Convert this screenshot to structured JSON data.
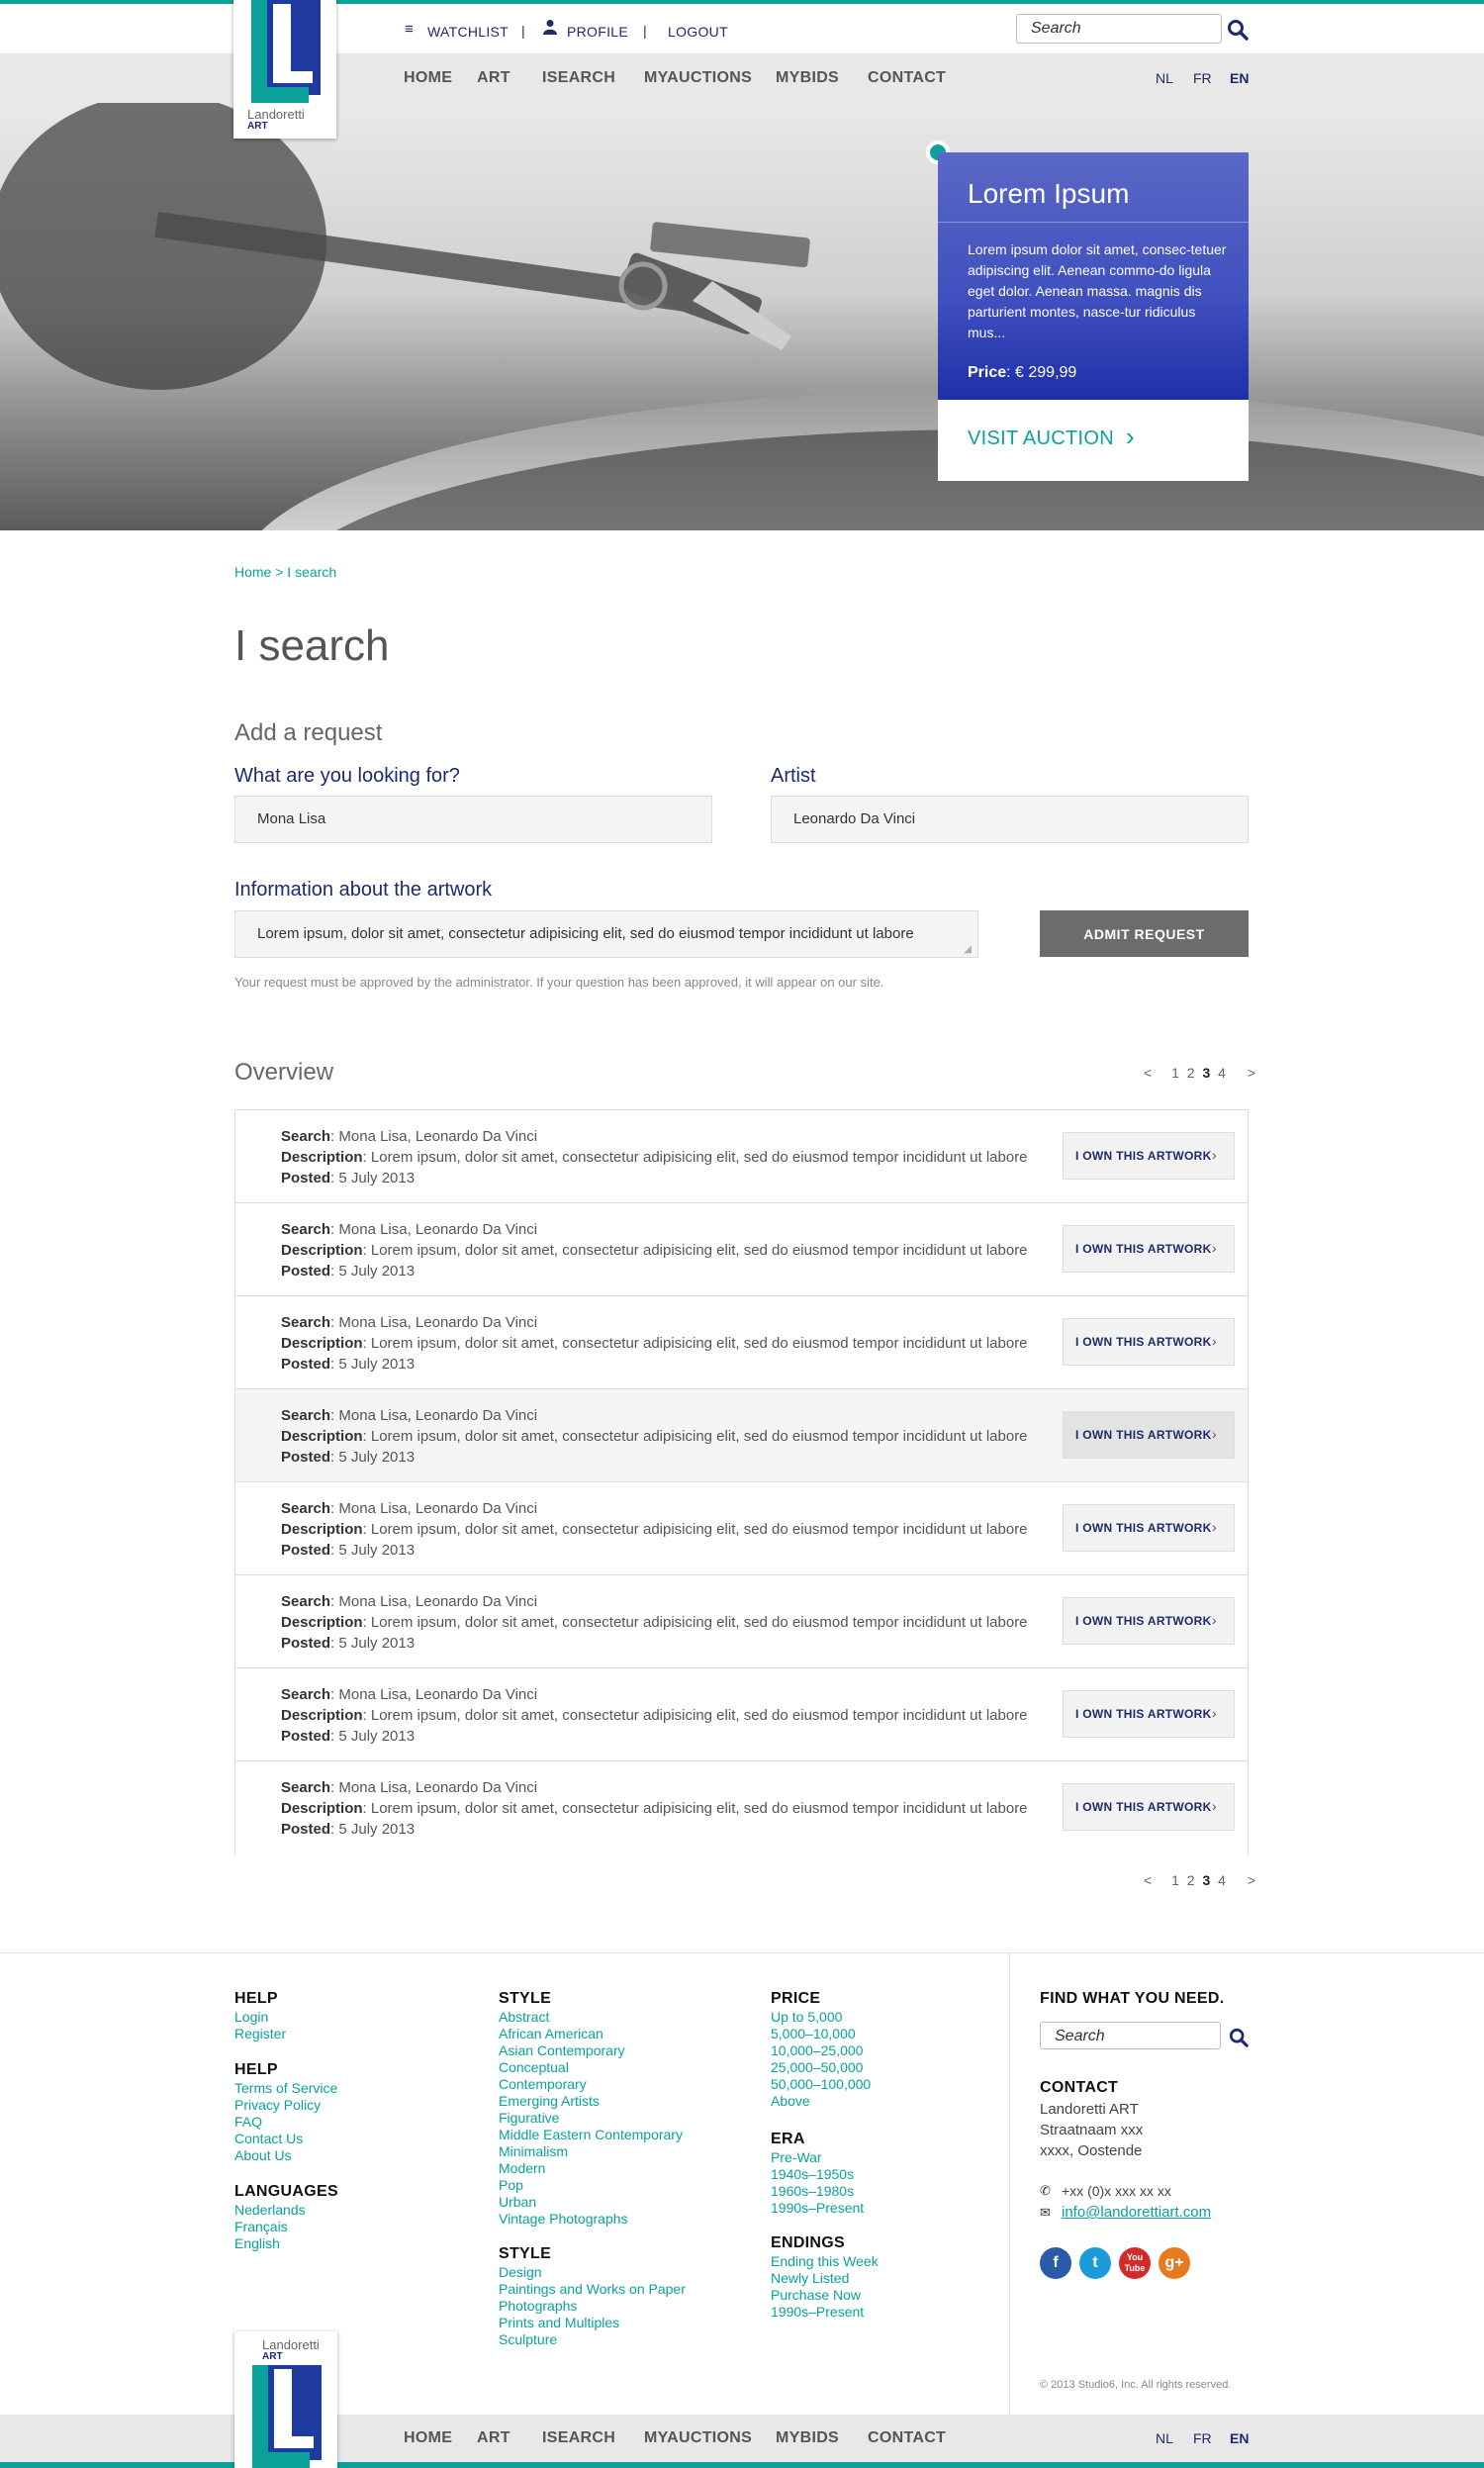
{
  "header": {
    "watchlist": "WATCHLIST",
    "profile": "PROFILE",
    "logout": "LOGOUT",
    "separator": "|",
    "search_placeholder": "Search",
    "logo_name": "Landoretti",
    "logo_art": "ART",
    "logo_letter": "L"
  },
  "nav": {
    "items": [
      "HOME",
      "ART",
      "ISEARCH",
      "MYAUCTIONS",
      "MYBIDS",
      "CONTACT"
    ],
    "languages": [
      "NL",
      "FR",
      "EN"
    ],
    "active_language": "EN"
  },
  "hero": {
    "title": "Lorem Ipsum",
    "body": "Lorem ipsum dolor sit amet, consec-tetuer adipiscing elit. Aenean commo-do ligula eget dolor. Aenean massa. magnis dis parturient montes, nasce-tur ridiculus mus...",
    "price_label": "Price",
    "price_value": "€ 299,99",
    "cta": "VISIT AUCTION",
    "cta_chevron": "›"
  },
  "breadcrumb": "Home > I search",
  "page_title": "I search",
  "form": {
    "heading": "Add a request",
    "what_label": "What are you looking for?",
    "what_value": "Mona Lisa",
    "artist_label": "Artist",
    "artist_value": "Leonardo Da Vinci",
    "info_label": "Information about the artwork",
    "info_value": "Lorem ipsum, dolor sit amet, consectetur adipisicing elit, sed do eiusmod tempor incididunt ut labore",
    "submit": "ADMIT REQUEST",
    "note": "Your request must be approved by the administrator. If your question has been approved, it will appear on our site."
  },
  "overview": {
    "heading": "Overview",
    "pager": {
      "prev": "<",
      "pages": [
        "1",
        "2",
        "3",
        "4"
      ],
      "current": "3",
      "next": ">"
    },
    "labels": {
      "search": "Search",
      "description": "Description",
      "posted": "Posted"
    },
    "button": "I OWN THIS ARTWORK",
    "button_chevron": "›",
    "rows": [
      {
        "search": "Mona Lisa, Leonardo Da Vinci",
        "description": "Lorem ipsum, dolor sit amet, consectetur adipisicing elit, sed do eiusmod tempor incididunt ut labore",
        "posted": "5 July 2013"
      },
      {
        "search": "Mona Lisa, Leonardo Da Vinci",
        "description": "Lorem ipsum, dolor sit amet, consectetur adipisicing elit, sed do eiusmod tempor incididunt ut labore",
        "posted": "5 July 2013"
      },
      {
        "search": "Mona Lisa, Leonardo Da Vinci",
        "description": "Lorem ipsum, dolor sit amet, consectetur adipisicing elit, sed do eiusmod tempor incididunt ut labore",
        "posted": "5 July 2013"
      },
      {
        "search": "Mona Lisa, Leonardo Da Vinci",
        "description": "Lorem ipsum, dolor sit amet, consectetur adipisicing elit, sed do eiusmod tempor incididunt ut labore",
        "posted": "5 July 2013"
      },
      {
        "search": "Mona Lisa, Leonardo Da Vinci",
        "description": "Lorem ipsum, dolor sit amet, consectetur adipisicing elit, sed do eiusmod tempor incididunt ut labore",
        "posted": "5 July 2013"
      },
      {
        "search": "Mona Lisa, Leonardo Da Vinci",
        "description": "Lorem ipsum, dolor sit amet, consectetur adipisicing elit, sed do eiusmod tempor incididunt ut labore",
        "posted": "5 July 2013"
      },
      {
        "search": "Mona Lisa, Leonardo Da Vinci",
        "description": "Lorem ipsum, dolor sit amet, consectetur adipisicing elit, sed do eiusmod tempor incididunt ut labore",
        "posted": "5 July 2013"
      },
      {
        "search": "Mona Lisa, Leonardo Da Vinci",
        "description": "Lorem ipsum, dolor sit amet, consectetur adipisicing elit, sed do eiusmod tempor incididunt ut labore",
        "posted": "5 July 2013"
      }
    ]
  },
  "footer": {
    "help1": {
      "heading": "HELP",
      "links": [
        "Login",
        "Register"
      ]
    },
    "help2": {
      "heading": "HELP",
      "links": [
        "Terms of Service",
        "Privacy Policy",
        "FAQ",
        "Contact Us",
        "About Us"
      ]
    },
    "languages": {
      "heading": "LANGUAGES",
      "links": [
        "Nederlands",
        "Français",
        "English"
      ]
    },
    "style1": {
      "heading": "STYLE",
      "links": [
        "Abstract",
        "African American",
        "Asian Contemporary",
        "Conceptual",
        "Contemporary",
        "Emerging Artists",
        "Figurative",
        "Middle Eastern Contemporary",
        "Minimalism",
        "Modern",
        "Pop",
        "Urban",
        "Vintage Photographs"
      ]
    },
    "style2": {
      "heading": "STYLE",
      "links": [
        "Design",
        "Paintings and Works on Paper",
        "Photographs",
        "Prints and Multiples",
        "Sculpture"
      ]
    },
    "price": {
      "heading": "PRICE",
      "links": [
        "Up to 5,000",
        "5,000–10,000",
        "10,000–25,000",
        "25,000–50,000",
        "50,000–100,000",
        "Above"
      ]
    },
    "era": {
      "heading": "ERA",
      "links": [
        "Pre-War",
        "1940s–1950s",
        "1960s–1980s",
        "1990s–Present"
      ]
    },
    "endings": {
      "heading": "ENDINGS",
      "links": [
        "Ending this Week",
        "Newly Listed",
        "Purchase Now",
        "1990s–Present"
      ]
    },
    "find": {
      "heading": "FIND WHAT YOU NEED.",
      "search_placeholder": "Search"
    },
    "contact": {
      "heading": "CONTACT",
      "lines": [
        "Landoretti ART",
        "Straatnaam xxx",
        "xxxx, Oostende"
      ],
      "phone": "+xx (0)x xxx xx xx",
      "email": "info@landorettiart.com"
    },
    "social": [
      {
        "name": "facebook",
        "glyph": "f",
        "color": "#2a5aa8"
      },
      {
        "name": "twitter",
        "glyph": "t",
        "color": "#1d9bd8"
      },
      {
        "name": "youtube",
        "glyph": "You Tube",
        "color": "#d42a2a"
      },
      {
        "name": "googleplus",
        "glyph": "g+",
        "color": "#e67a1e"
      }
    ],
    "copyright": "© 2013 Studio6, Inc. All rights reserved."
  },
  "colors": {
    "accent": "#0aa19a",
    "brand_blue": "#1f2a6b",
    "button_gray": "#6c6c6c"
  }
}
